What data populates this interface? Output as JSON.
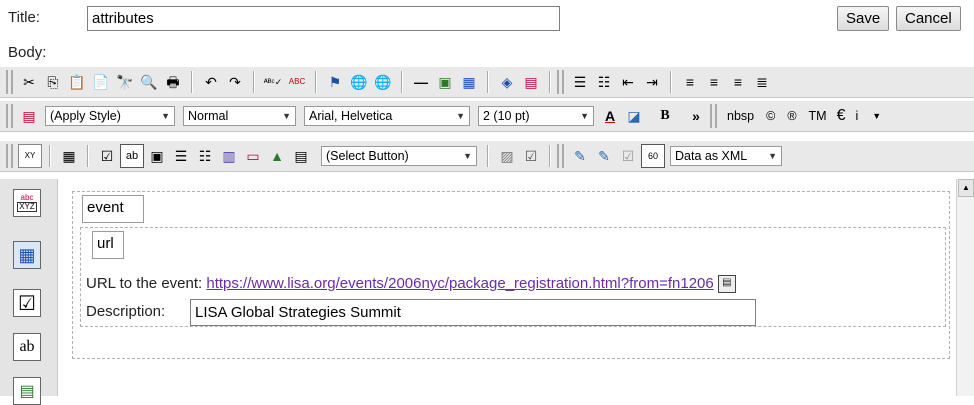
{
  "form": {
    "title_label": "Title:",
    "title_value": "attributes",
    "body_label": "Body:",
    "save_label": "Save",
    "cancel_label": "Cancel"
  },
  "toolbar2": {
    "style_select": "(Apply Style)",
    "format_select": "Normal",
    "font_select": "Arial, Helvetica",
    "size_select": "2 (10 pt)",
    "bold": "B",
    "more": "»",
    "nbsp": "nbsp",
    "copyright": "©",
    "registered": "®",
    "trademark": "TM",
    "euro": "€",
    "italic_i": "i"
  },
  "toolbar3": {
    "select_button": "(Select Button)",
    "data_select": "Data as XML"
  },
  "content": {
    "event_tag": "event",
    "url_tag": "url",
    "url_label": "URL to the event:",
    "url_value": "https://www.lisa.org/events/2006nyc/package_registration.html?from=fn1206",
    "description_label": "Description:",
    "description_value": "LISA Global Strategies Summit"
  }
}
